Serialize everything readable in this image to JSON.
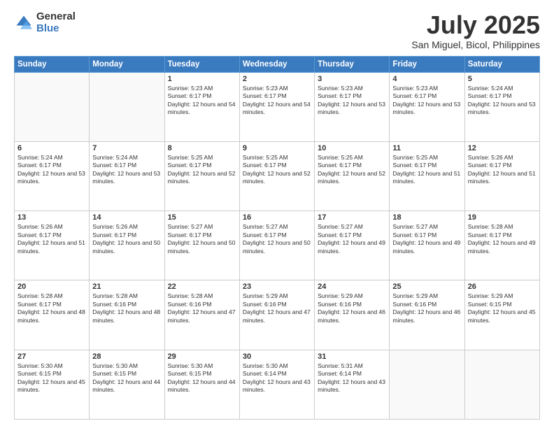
{
  "logo": {
    "general": "General",
    "blue": "Blue"
  },
  "header": {
    "month": "July 2025",
    "location": "San Miguel, Bicol, Philippines"
  },
  "weekdays": [
    "Sunday",
    "Monday",
    "Tuesday",
    "Wednesday",
    "Thursday",
    "Friday",
    "Saturday"
  ],
  "weeks": [
    [
      {
        "day": "",
        "sunrise": "",
        "sunset": "",
        "daylight": ""
      },
      {
        "day": "",
        "sunrise": "",
        "sunset": "",
        "daylight": ""
      },
      {
        "day": "1",
        "sunrise": "Sunrise: 5:23 AM",
        "sunset": "Sunset: 6:17 PM",
        "daylight": "Daylight: 12 hours and 54 minutes."
      },
      {
        "day": "2",
        "sunrise": "Sunrise: 5:23 AM",
        "sunset": "Sunset: 6:17 PM",
        "daylight": "Daylight: 12 hours and 54 minutes."
      },
      {
        "day": "3",
        "sunrise": "Sunrise: 5:23 AM",
        "sunset": "Sunset: 6:17 PM",
        "daylight": "Daylight: 12 hours and 53 minutes."
      },
      {
        "day": "4",
        "sunrise": "Sunrise: 5:23 AM",
        "sunset": "Sunset: 6:17 PM",
        "daylight": "Daylight: 12 hours and 53 minutes."
      },
      {
        "day": "5",
        "sunrise": "Sunrise: 5:24 AM",
        "sunset": "Sunset: 6:17 PM",
        "daylight": "Daylight: 12 hours and 53 minutes."
      }
    ],
    [
      {
        "day": "6",
        "sunrise": "Sunrise: 5:24 AM",
        "sunset": "Sunset: 6:17 PM",
        "daylight": "Daylight: 12 hours and 53 minutes."
      },
      {
        "day": "7",
        "sunrise": "Sunrise: 5:24 AM",
        "sunset": "Sunset: 6:17 PM",
        "daylight": "Daylight: 12 hours and 53 minutes."
      },
      {
        "day": "8",
        "sunrise": "Sunrise: 5:25 AM",
        "sunset": "Sunset: 6:17 PM",
        "daylight": "Daylight: 12 hours and 52 minutes."
      },
      {
        "day": "9",
        "sunrise": "Sunrise: 5:25 AM",
        "sunset": "Sunset: 6:17 PM",
        "daylight": "Daylight: 12 hours and 52 minutes."
      },
      {
        "day": "10",
        "sunrise": "Sunrise: 5:25 AM",
        "sunset": "Sunset: 6:17 PM",
        "daylight": "Daylight: 12 hours and 52 minutes."
      },
      {
        "day": "11",
        "sunrise": "Sunrise: 5:25 AM",
        "sunset": "Sunset: 6:17 PM",
        "daylight": "Daylight: 12 hours and 51 minutes."
      },
      {
        "day": "12",
        "sunrise": "Sunrise: 5:26 AM",
        "sunset": "Sunset: 6:17 PM",
        "daylight": "Daylight: 12 hours and 51 minutes."
      }
    ],
    [
      {
        "day": "13",
        "sunrise": "Sunrise: 5:26 AM",
        "sunset": "Sunset: 6:17 PM",
        "daylight": "Daylight: 12 hours and 51 minutes."
      },
      {
        "day": "14",
        "sunrise": "Sunrise: 5:26 AM",
        "sunset": "Sunset: 6:17 PM",
        "daylight": "Daylight: 12 hours and 50 minutes."
      },
      {
        "day": "15",
        "sunrise": "Sunrise: 5:27 AM",
        "sunset": "Sunset: 6:17 PM",
        "daylight": "Daylight: 12 hours and 50 minutes."
      },
      {
        "day": "16",
        "sunrise": "Sunrise: 5:27 AM",
        "sunset": "Sunset: 6:17 PM",
        "daylight": "Daylight: 12 hours and 50 minutes."
      },
      {
        "day": "17",
        "sunrise": "Sunrise: 5:27 AM",
        "sunset": "Sunset: 6:17 PM",
        "daylight": "Daylight: 12 hours and 49 minutes."
      },
      {
        "day": "18",
        "sunrise": "Sunrise: 5:27 AM",
        "sunset": "Sunset: 6:17 PM",
        "daylight": "Daylight: 12 hours and 49 minutes."
      },
      {
        "day": "19",
        "sunrise": "Sunrise: 5:28 AM",
        "sunset": "Sunset: 6:17 PM",
        "daylight": "Daylight: 12 hours and 49 minutes."
      }
    ],
    [
      {
        "day": "20",
        "sunrise": "Sunrise: 5:28 AM",
        "sunset": "Sunset: 6:17 PM",
        "daylight": "Daylight: 12 hours and 48 minutes."
      },
      {
        "day": "21",
        "sunrise": "Sunrise: 5:28 AM",
        "sunset": "Sunset: 6:16 PM",
        "daylight": "Daylight: 12 hours and 48 minutes."
      },
      {
        "day": "22",
        "sunrise": "Sunrise: 5:28 AM",
        "sunset": "Sunset: 6:16 PM",
        "daylight": "Daylight: 12 hours and 47 minutes."
      },
      {
        "day": "23",
        "sunrise": "Sunrise: 5:29 AM",
        "sunset": "Sunset: 6:16 PM",
        "daylight": "Daylight: 12 hours and 47 minutes."
      },
      {
        "day": "24",
        "sunrise": "Sunrise: 5:29 AM",
        "sunset": "Sunset: 6:16 PM",
        "daylight": "Daylight: 12 hours and 46 minutes."
      },
      {
        "day": "25",
        "sunrise": "Sunrise: 5:29 AM",
        "sunset": "Sunset: 6:16 PM",
        "daylight": "Daylight: 12 hours and 46 minutes."
      },
      {
        "day": "26",
        "sunrise": "Sunrise: 5:29 AM",
        "sunset": "Sunset: 6:15 PM",
        "daylight": "Daylight: 12 hours and 45 minutes."
      }
    ],
    [
      {
        "day": "27",
        "sunrise": "Sunrise: 5:30 AM",
        "sunset": "Sunset: 6:15 PM",
        "daylight": "Daylight: 12 hours and 45 minutes."
      },
      {
        "day": "28",
        "sunrise": "Sunrise: 5:30 AM",
        "sunset": "Sunset: 6:15 PM",
        "daylight": "Daylight: 12 hours and 44 minutes."
      },
      {
        "day": "29",
        "sunrise": "Sunrise: 5:30 AM",
        "sunset": "Sunset: 6:15 PM",
        "daylight": "Daylight: 12 hours and 44 minutes."
      },
      {
        "day": "30",
        "sunrise": "Sunrise: 5:30 AM",
        "sunset": "Sunset: 6:14 PM",
        "daylight": "Daylight: 12 hours and 43 minutes."
      },
      {
        "day": "31",
        "sunrise": "Sunrise: 5:31 AM",
        "sunset": "Sunset: 6:14 PM",
        "daylight": "Daylight: 12 hours and 43 minutes."
      },
      {
        "day": "",
        "sunrise": "",
        "sunset": "",
        "daylight": ""
      },
      {
        "day": "",
        "sunrise": "",
        "sunset": "",
        "daylight": ""
      }
    ]
  ]
}
